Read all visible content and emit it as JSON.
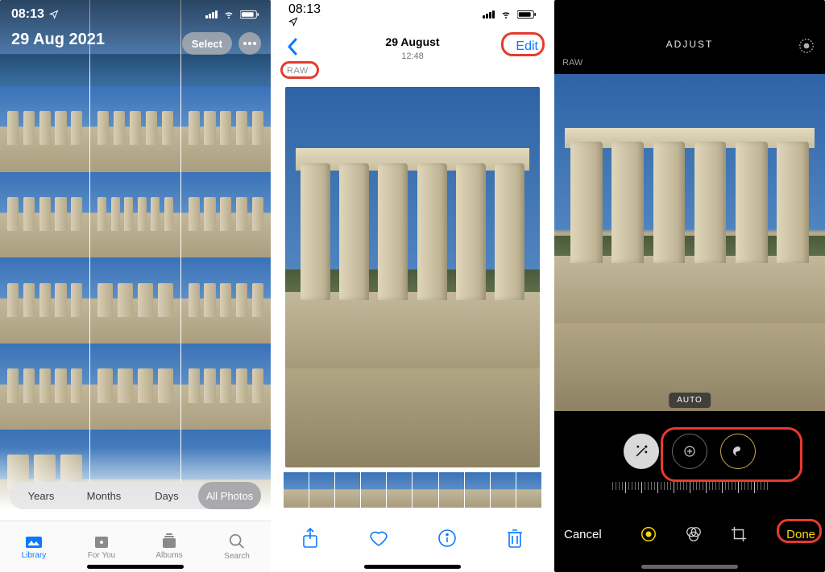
{
  "pane1": {
    "status_time": "08:13",
    "date_title": "29 Aug 2021",
    "select_label": "Select",
    "segments": {
      "years": "Years",
      "months": "Months",
      "days": "Days",
      "all": "All Photos"
    },
    "tabs": {
      "library": "Library",
      "foryou": "For You",
      "albums": "Albums",
      "search": "Search"
    }
  },
  "pane2": {
    "status_time": "08:13",
    "nav_title": "29 August",
    "nav_subtitle": "12:48",
    "edit_label": "Edit",
    "raw_badge": "RAW"
  },
  "pane3": {
    "header_title": "ADJUST",
    "raw_badge": "RAW",
    "auto_label": "AUTO",
    "cancel_label": "Cancel",
    "done_label": "Done"
  }
}
